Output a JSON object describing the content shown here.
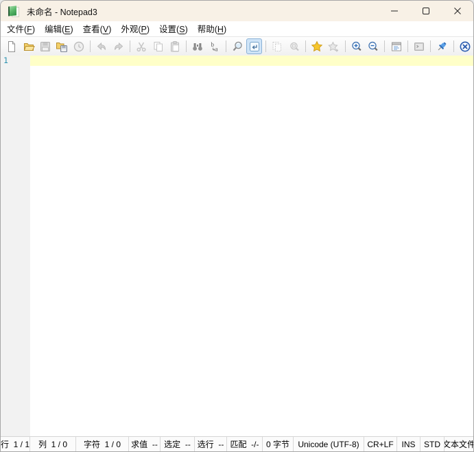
{
  "window": {
    "title": "未命名 - Notepad3"
  },
  "menu": {
    "items": [
      {
        "name": "file",
        "label": "文件",
        "key": "F"
      },
      {
        "name": "edit",
        "label": "编辑",
        "key": "E"
      },
      {
        "name": "view",
        "label": "查看",
        "key": "V"
      },
      {
        "name": "appearance",
        "label": "外观",
        "key": "P"
      },
      {
        "name": "settings",
        "label": "设置",
        "key": "S"
      },
      {
        "name": "help",
        "label": "帮助",
        "key": "H"
      }
    ]
  },
  "toolbar": {
    "buttons": [
      {
        "name": "new-file-button",
        "icon": "new-file-icon",
        "state": "enabled",
        "sep_after": false
      },
      {
        "name": "open-file-button",
        "icon": "open-folder-icon",
        "state": "enabled",
        "sep_after": false
      },
      {
        "name": "save-button",
        "icon": "floppy-save-icon",
        "state": "disabled",
        "sep_after": false
      },
      {
        "name": "save-as-button",
        "icon": "folder-floppy-icon",
        "state": "enabled",
        "sep_after": false
      },
      {
        "name": "file-history-button",
        "icon": "history-clock-icon",
        "state": "disabled",
        "sep_after": true
      },
      {
        "name": "undo-button",
        "icon": "undo-arrow-icon",
        "state": "disabled",
        "sep_after": false
      },
      {
        "name": "redo-button",
        "icon": "redo-arrow-icon",
        "state": "disabled",
        "sep_after": true
      },
      {
        "name": "cut-button",
        "icon": "scissors-icon",
        "state": "disabled",
        "sep_after": false
      },
      {
        "name": "copy-button",
        "icon": "copy-pages-icon",
        "state": "disabled",
        "sep_after": false
      },
      {
        "name": "paste-button",
        "icon": "clipboard-paste-icon",
        "state": "disabled",
        "sep_after": true
      },
      {
        "name": "find-button",
        "icon": "binoculars-icon",
        "state": "enabled",
        "sep_after": false
      },
      {
        "name": "replace-button",
        "icon": "replace-ba-icon",
        "state": "enabled",
        "sep_after": true
      },
      {
        "name": "search-document-button",
        "icon": "magnifier-document-icon",
        "state": "enabled",
        "sep_after": false
      },
      {
        "name": "word-wrap-button",
        "icon": "word-wrap-return-icon",
        "state": "active",
        "sep_after": true
      },
      {
        "name": "save-copy-button",
        "icon": "light-pages-icon",
        "state": "disabled",
        "sep_after": false
      },
      {
        "name": "reset-zoom-button",
        "icon": "magnifier-selection-icon",
        "state": "disabled",
        "sep_after": true
      },
      {
        "name": "open-favorites-button",
        "icon": "star-icon",
        "state": "enabled",
        "sep_after": false
      },
      {
        "name": "add-favorite-button",
        "icon": "star-plus-icon",
        "state": "disabled",
        "sep_after": true
      },
      {
        "name": "zoom-in-button",
        "icon": "magnifier-plus-icon",
        "state": "enabled",
        "sep_after": false
      },
      {
        "name": "zoom-out-button",
        "icon": "magnifier-minus-icon",
        "state": "enabled",
        "sep_after": true
      },
      {
        "name": "settings-button",
        "icon": "properties-window-icon",
        "state": "enabled",
        "sep_after": true
      },
      {
        "name": "execute-button",
        "icon": "terminal-window-icon",
        "state": "disabled",
        "sep_after": true
      },
      {
        "name": "pin-on-top-button",
        "icon": "pushpin-icon",
        "state": "enabled",
        "sep_after": true
      },
      {
        "name": "exit-button",
        "icon": "circle-x-icon",
        "state": "enabled",
        "sep_after": false
      }
    ]
  },
  "editor": {
    "line_numbers": [
      "1"
    ],
    "text": "",
    "caret_line": 1
  },
  "status_bar": {
    "segments": [
      {
        "name": "line-position",
        "text": "行  1 / 1"
      },
      {
        "name": "column-position",
        "text": "列  1 / 0"
      },
      {
        "name": "character-position",
        "text": "字符  1 / 0"
      },
      {
        "name": "evaluation",
        "text": "求值  --"
      },
      {
        "name": "selection",
        "text": "选定  --"
      },
      {
        "name": "selected-lines",
        "text": "选行  --"
      },
      {
        "name": "occurrences",
        "text": "匹配  -/-"
      },
      {
        "name": "file-size",
        "text": "0 字节"
      },
      {
        "name": "encoding",
        "text": "Unicode (UTF-8)"
      },
      {
        "name": "eol-mode",
        "text": "CR+LF"
      },
      {
        "name": "insert-mode",
        "text": "INS"
      },
      {
        "name": "override-mode",
        "text": "STD"
      },
      {
        "name": "file-scheme",
        "text": "文本文件"
      }
    ]
  },
  "colors": {
    "titlebar_bg": "#f8f1e6",
    "current_line_highlight": "#ffffc8",
    "line_number_fg": "#2b91af",
    "active_toggle_bg": "#cfe4f7",
    "active_toggle_border": "#8ab1d6",
    "accent_blue": "#2f5fb0",
    "star_yellow": "#f6c62d"
  }
}
